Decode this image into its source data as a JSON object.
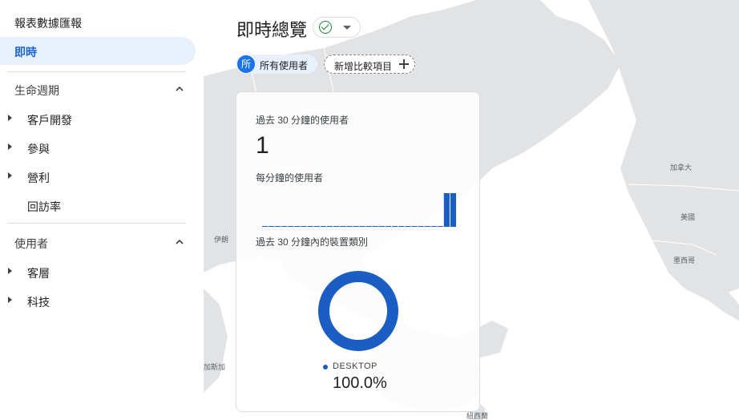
{
  "sidebar": {
    "title": "報表數據匯報",
    "active": "即時",
    "sections": [
      {
        "label": "生命週期",
        "items": [
          "客戶開發",
          "參與",
          "營利",
          "回訪率"
        ]
      },
      {
        "label": "使用者",
        "items": [
          "客層",
          "科技"
        ]
      }
    ]
  },
  "header": {
    "title": "即時總覽",
    "chips": {
      "all_users_avatar": "所",
      "all_users": "所有使用者",
      "add_comparison": "新增比較項目"
    }
  },
  "map_labels": [
    "加拿大",
    "美國",
    "墨西哥",
    "伊朗",
    "加斯加",
    "紐西蘭"
  ],
  "card": {
    "users_30min_label": "過去 30 分鐘的使用者",
    "users_30min_value": "1",
    "per_minute_label": "每分鐘的使用者",
    "device_label": "過去 30 分鐘內的裝置類別",
    "device_category": "DESKTOP",
    "device_percent": "100.0%"
  },
  "colors": {
    "accent": "#1a73e8",
    "bar": "#1a5ec4",
    "donut": "#1a5ec4",
    "active_bg": "#e8f0fe"
  },
  "chart_data": {
    "type": "bar",
    "title": "每分鐘的使用者",
    "categories": [
      "-30",
      "-29",
      "-28",
      "-27",
      "-26",
      "-25",
      "-24",
      "-23",
      "-22",
      "-21",
      "-20",
      "-19",
      "-18",
      "-17",
      "-16",
      "-15",
      "-14",
      "-13",
      "-12",
      "-11",
      "-10",
      "-9",
      "-8",
      "-7",
      "-6",
      "-5",
      "-4",
      "-3",
      "-2",
      "-1"
    ],
    "values": [
      0,
      0,
      0,
      0,
      0,
      0,
      0,
      0,
      0,
      0,
      0,
      0,
      0,
      0,
      0,
      0,
      0,
      0,
      0,
      0,
      0,
      0,
      0,
      0,
      0,
      0,
      0,
      0,
      1,
      1
    ],
    "donut": {
      "type": "pie",
      "labels": [
        "DESKTOP"
      ],
      "values": [
        100.0
      ]
    }
  }
}
